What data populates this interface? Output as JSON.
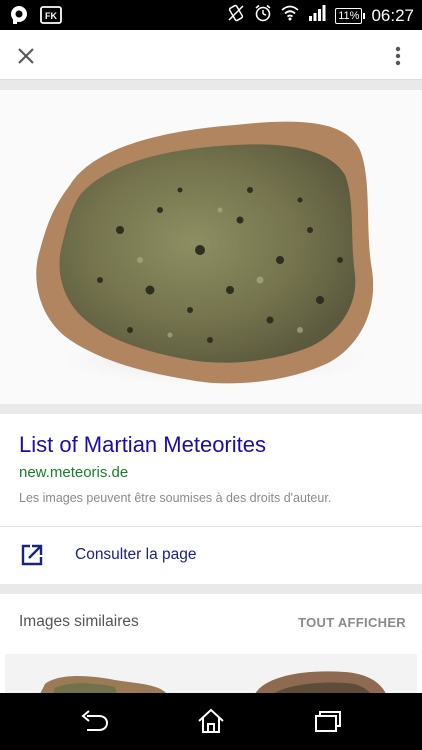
{
  "status_bar": {
    "battery": "11%",
    "time": "06:27",
    "icons": [
      "chat-notification-icon",
      "fk-app-icon",
      "vibrate-icon",
      "alarm-icon",
      "wifi-icon",
      "signal-icon",
      "battery-icon"
    ]
  },
  "app_bar": {
    "close_icon": "close-icon",
    "menu_icon": "more-vert-icon"
  },
  "result": {
    "title": "List of Martian Meteorites",
    "url": "new.meteoris.de",
    "copyright_note": "Les images peuvent être soumises à des droits d'auteur.",
    "open_label": "Consulter la page",
    "open_icon": "open-in-new-icon",
    "link_color": "#1a0dab",
    "url_color": "#15802a"
  },
  "similar": {
    "title": "Images similaires",
    "show_all": "TOUT AFFICHER"
  },
  "nav_bar": {
    "icons": [
      "back-icon",
      "home-icon",
      "recent-apps-icon"
    ]
  }
}
